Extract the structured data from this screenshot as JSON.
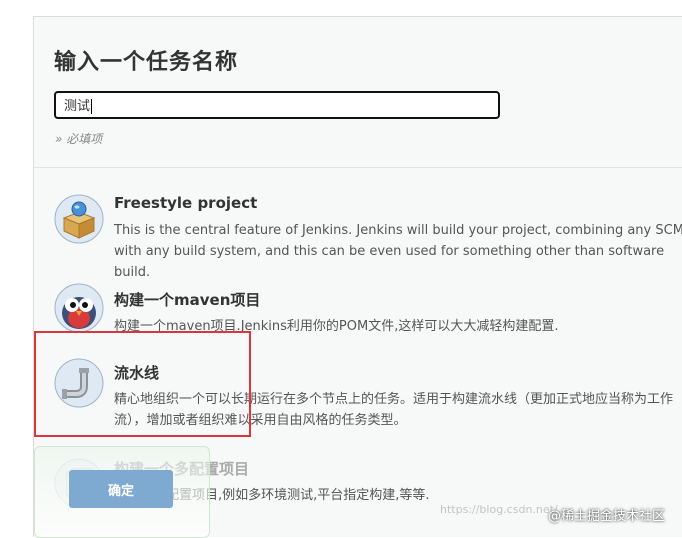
{
  "form": {
    "title": "输入一个任务名称",
    "item_name_value": "测试",
    "required_note": "» 必填项"
  },
  "items": [
    {
      "name": "Freestyle project",
      "description": "This is the central feature of Jenkins. Jenkins will build your project, combining any SCM with any build system, and this can be even used for something other than software build.",
      "icon": "box-icon"
    },
    {
      "name": "构建一个maven项目",
      "description": "构建一个maven项目.Jenkins利用你的POM文件,这样可以大大减轻构建配置.",
      "icon": "maven-owl-icon"
    },
    {
      "name": "流水线",
      "description": "精心地组织一个可以长期运行在多个节点上的任务。适用于构建流水线（更加正式地应当称为工作流），增加或者组织难以采用自由风格的任务类型。",
      "icon": "pipeline-icon"
    },
    {
      "name": "构建一个多配置项目",
      "description": "适用于多配置项目,例如多环境测试,平台指定构建,等等.",
      "icon": "multi-config-icon"
    }
  ],
  "footer": {
    "ok_label": "确定"
  },
  "watermark": {
    "url": "https://blog.csdn.net/...",
    "brand": "@稀土掘金技术社区"
  },
  "colors": {
    "highlight": "#d9363e",
    "ok_button": "#7ea9d1",
    "panel_bg": "#f7f8f8"
  }
}
